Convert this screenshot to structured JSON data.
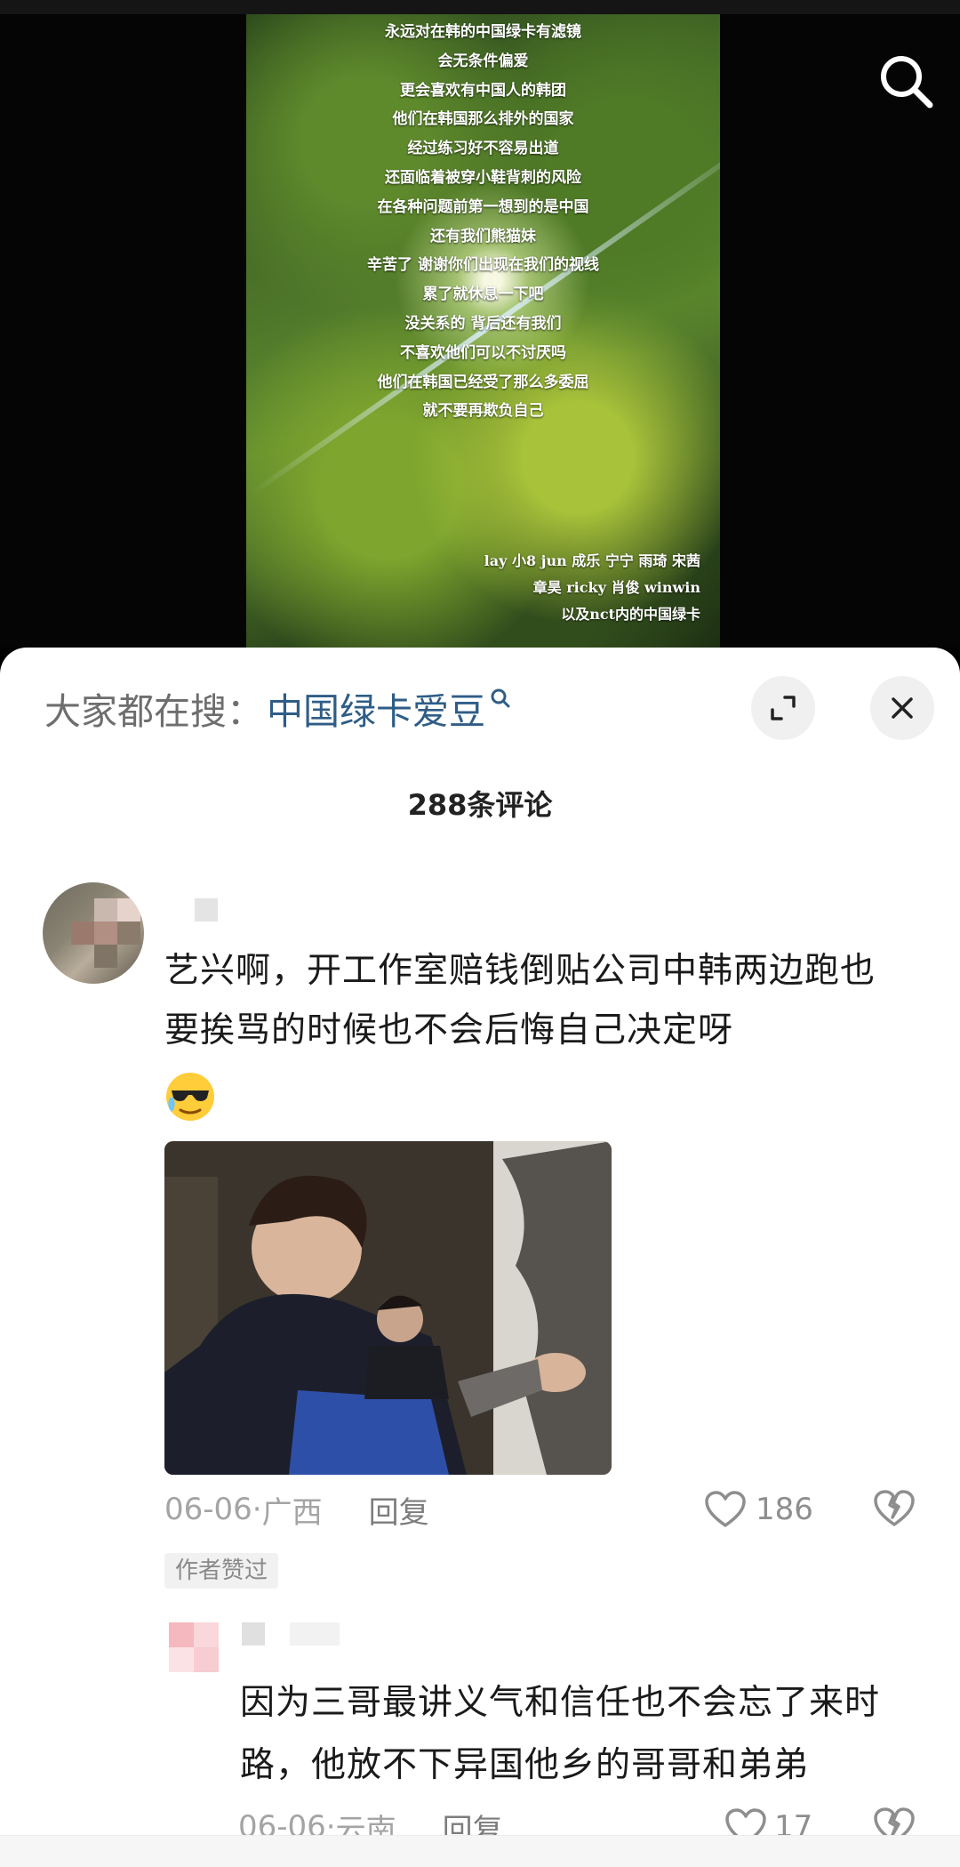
{
  "video": {
    "lyrics": [
      "永远对在韩的中国绿卡有滤镜",
      "会无条件偏爱",
      "更会喜欢有中国人的韩团",
      "他们在韩国那么排外的国家",
      "经过练习好不容易出道",
      "还面临着被穿小鞋背刺的风险",
      "在各种问题前第一想到的是中国",
      "还有我们熊猫妹",
      "辛苦了 谢谢你们出现在我们的视线",
      "累了就休息一下吧",
      "没关系的 背后还有我们",
      "不喜欢他们可以不讨厌吗",
      "他们在韩国已经受了那么多委屈",
      "就不要再欺负自己"
    ],
    "credits": [
      "lay 小8 jun 成乐 宁宁 雨琦 宋茜",
      "章昊 ricky 肖俊 winwin",
      "以及nct内的中国绿卡"
    ]
  },
  "search_icon": "search-icon",
  "hot_search": {
    "prefix": "大家都在搜：",
    "keyword": "中国绿卡爱豆"
  },
  "comment_count": "288条评论",
  "comments": [
    {
      "text": "艺兴啊，开工作室赔钱倒贴公司中韩两边跑也要挨骂的时候也不会后悔自己决定呀",
      "emoji": "cool-sweat-emoji",
      "date": "06-06",
      "location": "广西",
      "reply_label": "回复",
      "likes": "186",
      "author_liked": "作者赞过"
    },
    {
      "text": "因为三哥最讲义气和信任也不会忘了来时路，他放不下异国他乡的哥哥和弟弟",
      "date": "06-06",
      "location": "云南",
      "reply_label": "回复",
      "likes": "17"
    }
  ],
  "meta_separator": " · ",
  "colors": {
    "keyword": "#2f5d86",
    "meta": "#a4a4a4",
    "text": "#1a1a1a"
  }
}
